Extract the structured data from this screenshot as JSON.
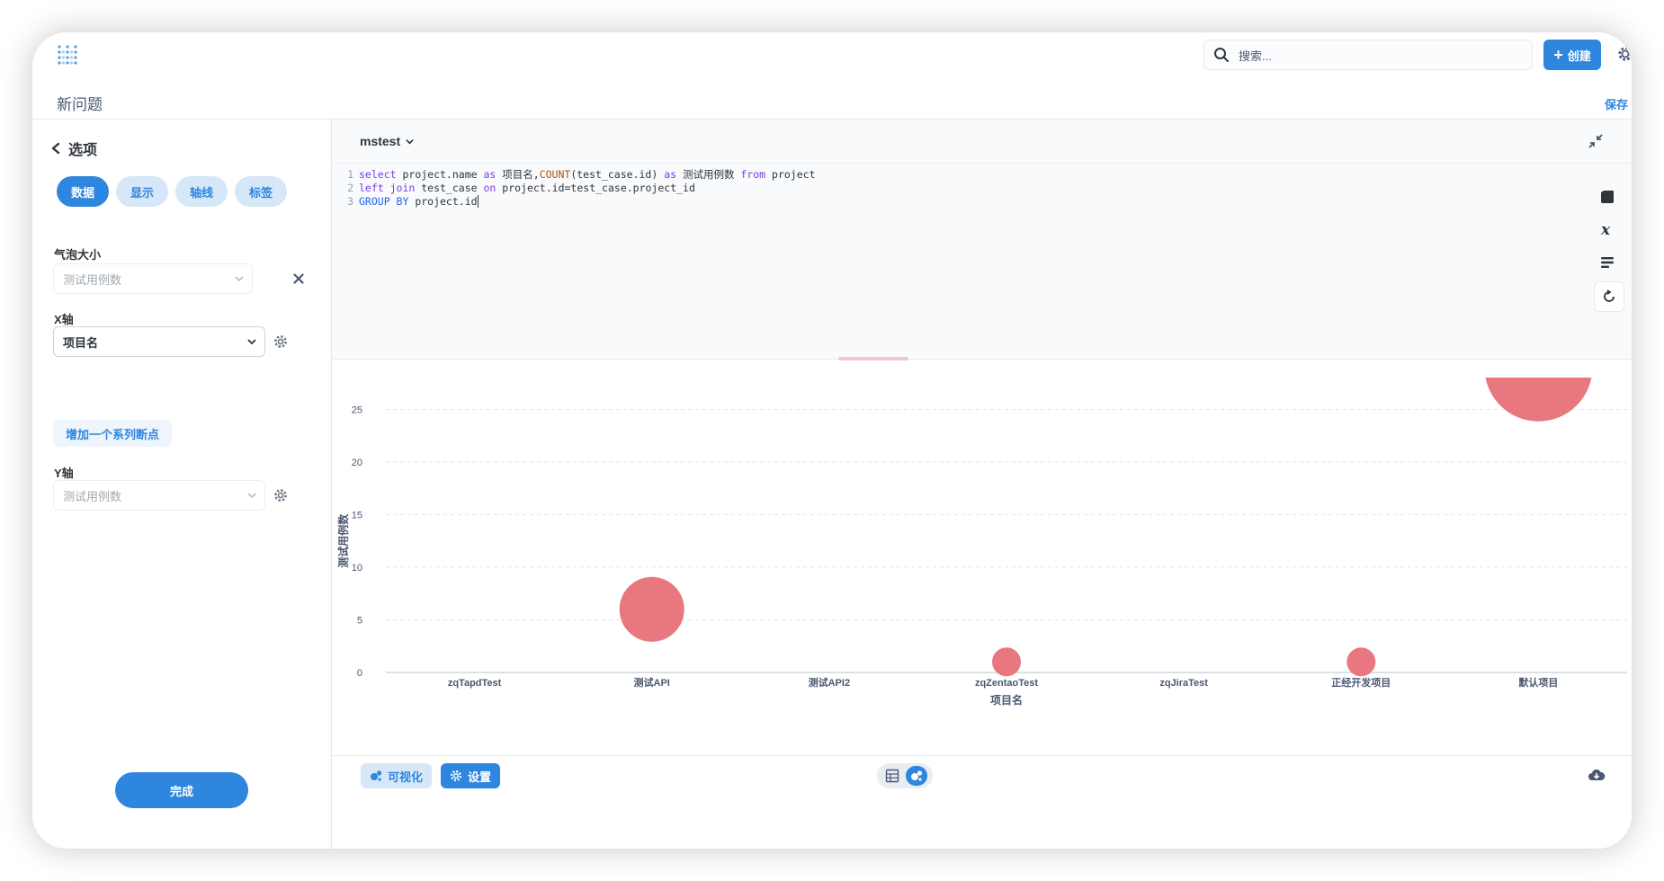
{
  "header": {
    "search_placeholder": "搜索...",
    "create_label": "创建",
    "page_title": "新问题",
    "save_label": "保存"
  },
  "sidebar": {
    "back_label": "选项",
    "tabs": [
      "数据",
      "显示",
      "轴线",
      "标签"
    ],
    "active_tab": "数据",
    "bubble_size": {
      "label": "气泡大小",
      "placeholder": "测试用例数"
    },
    "x_axis": {
      "label": "X轴",
      "value": "项目名"
    },
    "add_series_label": "增加一个系列断点",
    "y_axis": {
      "label": "Y轴",
      "placeholder": "测试用例数"
    },
    "done_label": "完成"
  },
  "editor": {
    "database": "mstest",
    "line_numbers": [
      "1",
      "2",
      "3"
    ]
  },
  "bottom_bar": {
    "visualize_label": "可视化",
    "settings_label": "设置"
  },
  "colors": {
    "accent": "#2e86de",
    "bubble": "#e8777f"
  },
  "chart_data": {
    "type": "scatter",
    "categories": [
      "zqTapdTest",
      "测试API",
      "测试API2",
      "zqZentaoTest",
      "zqJiraTest",
      "正经开发项目",
      "默认项目"
    ],
    "points": [
      {
        "x": "测试API",
        "y": 6,
        "size": 6
      },
      {
        "x": "zqZentaoTest",
        "y": 1,
        "size": 1
      },
      {
        "x": "正经开发项目",
        "y": 1,
        "size": 1
      },
      {
        "x": "默认项目",
        "y": 29,
        "size": 29
      }
    ],
    "xlabel": "项目名",
    "ylabel": "测试用例数",
    "yticks": [
      0,
      5,
      10,
      15,
      20,
      25
    ],
    "ylim": [
      0,
      30
    ],
    "grid": true
  }
}
